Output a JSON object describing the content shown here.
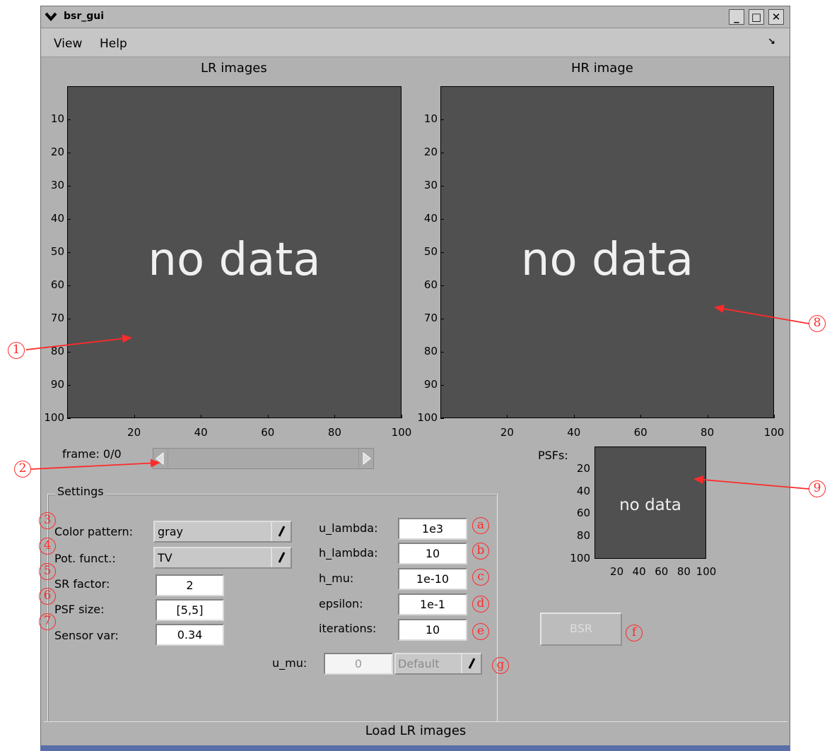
{
  "window": {
    "title": "bsr_gui",
    "buttons": {
      "minimize": "_",
      "maximize": "□",
      "close": "✕"
    }
  },
  "menu": {
    "items": [
      "View",
      "Help"
    ],
    "corner_icon": "↘"
  },
  "lr_panel": {
    "title": "LR images",
    "placeholder": "no data",
    "yticks": [
      "10",
      "20",
      "30",
      "40",
      "50",
      "60",
      "70",
      "80",
      "90",
      "100"
    ],
    "xticks": [
      "20",
      "40",
      "60",
      "80",
      "100"
    ]
  },
  "hr_panel": {
    "title": "HR image",
    "placeholder": "no data",
    "yticks": [
      "10",
      "20",
      "30",
      "40",
      "50",
      "60",
      "70",
      "80",
      "90",
      "100"
    ],
    "xticks": [
      "20",
      "40",
      "60",
      "80",
      "100"
    ]
  },
  "frame": {
    "label": "frame: 0/0"
  },
  "psf_panel": {
    "label": "PSFs:",
    "placeholder": "no data",
    "yticks": [
      "20",
      "40",
      "60",
      "80",
      "100"
    ],
    "xticks": [
      "20",
      "40",
      "60",
      "80",
      "100"
    ]
  },
  "settings": {
    "title": "Settings",
    "color_pattern": {
      "label": "Color pattern:",
      "value": "gray"
    },
    "pot_funct": {
      "label": "Pot. funct.:",
      "value": "TV"
    },
    "sr_factor": {
      "label": "SR factor:",
      "value": "2"
    },
    "psf_size": {
      "label": "PSF size:",
      "value": "[5,5]"
    },
    "sensor_var": {
      "label": "Sensor var:",
      "value": "0.34"
    },
    "u_lambda": {
      "label": "u_lambda:",
      "value": "1e3"
    },
    "h_lambda": {
      "label": "h_lambda:",
      "value": "10"
    },
    "h_mu": {
      "label": "h_mu:",
      "value": "1e-10"
    },
    "epsilon": {
      "label": "epsilon:",
      "value": "1e-1"
    },
    "iterations": {
      "label": "iterations:",
      "value": "10"
    },
    "u_mu": {
      "label": "u_mu:",
      "value": "0",
      "mode": "Default"
    }
  },
  "bsr_button": {
    "label": "BSR"
  },
  "load_button": {
    "label": "Load LR images"
  },
  "annotations": {
    "n1": "1",
    "n2": "2",
    "n3": "3",
    "n4": "4",
    "n5": "5",
    "n6": "6",
    "n7": "7",
    "n8": "8",
    "n9": "9",
    "a": "a",
    "b": "b",
    "c": "c",
    "d": "d",
    "e": "e",
    "f": "f",
    "g": "g"
  },
  "colors": {
    "window_bg": "#b1b1b1",
    "plot_bg": "#505050",
    "annotation": "#ff2a2a"
  }
}
